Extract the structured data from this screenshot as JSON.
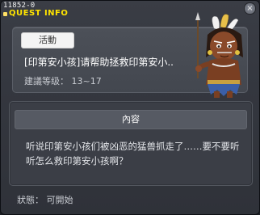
{
  "window": {
    "id_label": "11852-0",
    "title": "QUEST INFO",
    "close_label": "×"
  },
  "quest": {
    "badge_label": "活動",
    "title": "[印第安小孩]请帮助拯救印第安小..",
    "level_text": "建議等级： 13~17"
  },
  "content": {
    "header": "內容",
    "description": "听说印第安小孩们被凶恶的猛兽抓走了……要不要听听怎么救印第安小孩啊？"
  },
  "status": {
    "text": "狀態： 可開始"
  },
  "colors": {
    "title_accent": "#ffe400",
    "window_bg": "#34373f",
    "panel_bg": "#43474f"
  },
  "icons": {
    "npc": "indian-chief-npc-portrait"
  }
}
